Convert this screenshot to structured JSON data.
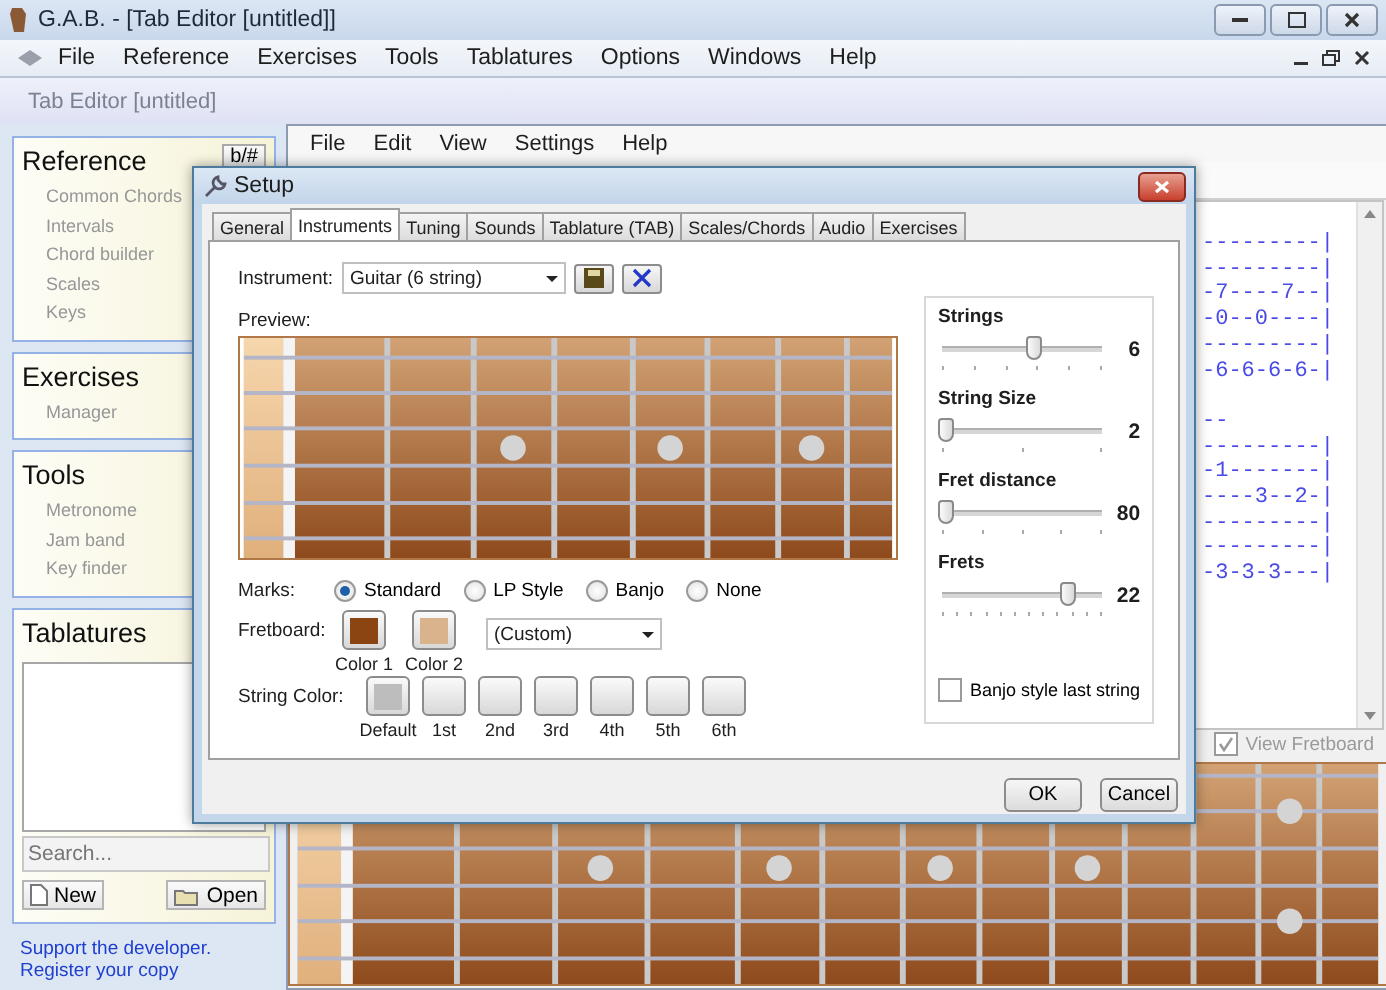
{
  "window": {
    "title": "G.A.B. - [Tab Editor [untitled]]"
  },
  "menu": [
    "File",
    "Reference",
    "Exercises",
    "Tools",
    "Tablatures",
    "Options",
    "Windows",
    "Help"
  ],
  "document_tab": "Tab Editor [untitled]",
  "sidebar": {
    "sections": [
      {
        "title": "Reference",
        "button": "b/#",
        "items": [
          "Common Chords",
          "Intervals",
          "Chord builder",
          "Scales",
          "Keys"
        ]
      },
      {
        "title": "Exercises",
        "items": [
          "Manager"
        ]
      },
      {
        "title": "Tools",
        "items": [
          "Metronome",
          "Jam band",
          "Key finder"
        ]
      }
    ],
    "tablatures": {
      "title": "Tablatures",
      "search_placeholder": "Search...",
      "buttons": [
        "New",
        "Open"
      ]
    },
    "support_link": "Support the developer. Register your copy"
  },
  "editor": {
    "menu": [
      "File",
      "Edit",
      "View",
      "Settings",
      "Help"
    ],
    "staffs": [
      [
        "---------|",
        "---------|",
        "-7----7--|",
        "-0--0----|",
        "---------|",
        "-6-6-6-6-|"
      ],
      [
        "---------|",
        "-1-------|",
        "----3--2-|",
        "---------|",
        "---------|",
        "-3-3-3---|"
      ]
    ],
    "separator": "--",
    "view_fretboard": {
      "label": "View Fretboard",
      "checked": true
    }
  },
  "dialog": {
    "title": "Setup",
    "tabs": [
      {
        "label": "General",
        "selected": false
      },
      {
        "label": "Instruments",
        "selected": true
      },
      {
        "label": "Tuning",
        "selected": false
      },
      {
        "label": "Sounds",
        "selected": false
      },
      {
        "label": "Tablature (TAB)",
        "selected": false
      },
      {
        "label": "Scales/Chords",
        "selected": false
      },
      {
        "label": "Audio",
        "selected": false
      },
      {
        "label": "Exercises",
        "selected": false
      }
    ],
    "instrument": {
      "label": "Instrument:",
      "value": "Guitar (6 string)"
    },
    "preview_label": "Preview:",
    "marks": {
      "label": "Marks:",
      "options": [
        {
          "label": "Standard",
          "selected": true
        },
        {
          "label": "LP Style",
          "selected": false
        },
        {
          "label": "Banjo",
          "selected": false
        },
        {
          "label": "None",
          "selected": false
        }
      ]
    },
    "fretboard": {
      "label": "Fretboard:",
      "colors": [
        {
          "label": "Color 1",
          "color": "#8b4513"
        },
        {
          "label": "Color 2",
          "color": "#d9b38c"
        }
      ],
      "preset": "(Custom)"
    },
    "string_color": {
      "label": "String Color:",
      "swatches": [
        {
          "label": "Default",
          "color": "#bdbdbd"
        },
        {
          "label": "1st"
        },
        {
          "label": "2nd"
        },
        {
          "label": "3rd"
        },
        {
          "label": "4th"
        },
        {
          "label": "5th"
        },
        {
          "label": "6th"
        }
      ]
    },
    "sliders": [
      {
        "label": "Strings",
        "level": 0.6,
        "reading": "6"
      },
      {
        "label": "String Size",
        "level": 0,
        "reading": "2"
      },
      {
        "label": "Fret distance",
        "level": 0,
        "reading": "80"
      },
      {
        "label": "Frets",
        "level": 0.82,
        "reading": "22"
      }
    ],
    "banjo": {
      "label": "Banjo style last string",
      "checked": false
    },
    "buttons": [
      "OK",
      "Cancel"
    ]
  }
}
